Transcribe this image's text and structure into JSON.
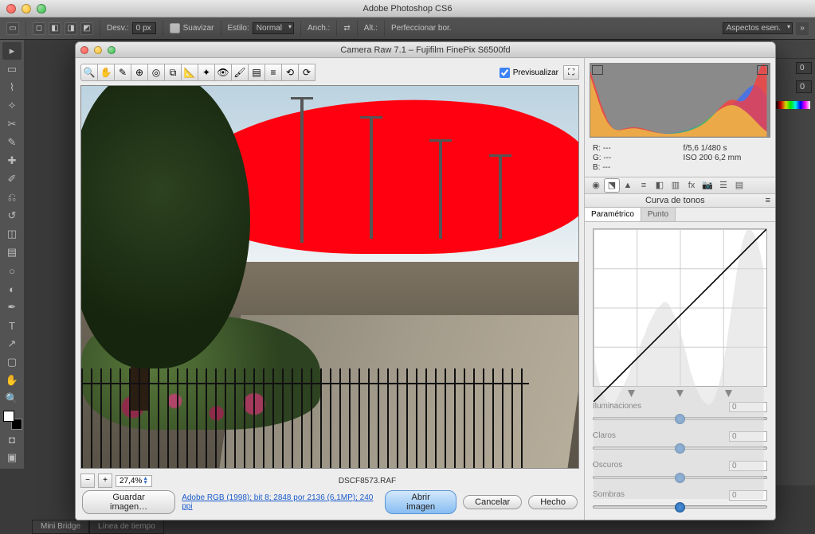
{
  "app": {
    "title": "Adobe Photoshop CS6"
  },
  "options": {
    "desv_label": "Desv.:",
    "desv_value": "0 px",
    "suavizar": "Suavizar",
    "estilo_label": "Estilo:",
    "estilo_value": "Normal",
    "anch": "Anch.:",
    "alt": "Alt.:",
    "perf": "Perfeccionar bor.",
    "workspace": "Aspectos esen."
  },
  "bottom_tabs": {
    "mini_bridge": "Mini Bridge",
    "timeline": "Línea de tiempo"
  },
  "right_panel": {
    "val0": "0",
    "val1": "0"
  },
  "cr": {
    "title": "Camera Raw 7.1  –  Fujifilm FinePix S6500fd",
    "preview": "Previsualizar",
    "zoom": "27,4%",
    "filename": "DSCF8573.RAF",
    "save_image": "Guardar imagen…",
    "link": "Adobe RGB (1998); bit 8; 2848 por 2136 (6,1MP); 240 ppi",
    "open": "Abrir imagen",
    "cancel": "Cancelar",
    "done": "Hecho",
    "histogram_meta": {
      "r": "R:   ---",
      "aperture_shutter": "f/5,6   1/480 s",
      "g": "G:   ---",
      "iso_focal": "ISO 200   6,2 mm",
      "b": "B:   ---"
    },
    "panel_title": "Curva de tonos",
    "tabs": {
      "param": "Paramétrico",
      "point": "Punto"
    },
    "sliders": {
      "iluminaciones": {
        "label": "Iluminaciones",
        "value": "0"
      },
      "claros": {
        "label": "Claros",
        "value": "0"
      },
      "oscuros": {
        "label": "Oscuros",
        "value": "0"
      },
      "sombras": {
        "label": "Sombras",
        "value": "0"
      }
    }
  },
  "chart_data": {
    "type": "line",
    "title": "Curva de tonos",
    "xlabel": "",
    "ylabel": "",
    "xlim": [
      0,
      255
    ],
    "ylim": [
      0,
      255
    ],
    "series": [
      {
        "name": "tone-curve",
        "values": [
          [
            0,
            0
          ],
          [
            64,
            64
          ],
          [
            128,
            128
          ],
          [
            192,
            192
          ],
          [
            255,
            255
          ]
        ]
      }
    ],
    "background_histogram": [
      55,
      48,
      44,
      40,
      38,
      36,
      35,
      35,
      36,
      38,
      40,
      42,
      44,
      46,
      49,
      51,
      53,
      56,
      59,
      61,
      64,
      66,
      68,
      70,
      71,
      72,
      73,
      73,
      72,
      70,
      68,
      65,
      62,
      59,
      55,
      51,
      47,
      44,
      41,
      39,
      37,
      36,
      35,
      35,
      36,
      38,
      41,
      45,
      50,
      56,
      63,
      70,
      77,
      84,
      90,
      95,
      98,
      100,
      100,
      99,
      97,
      94,
      90,
      85
    ],
    "rgb_histogram": {
      "bins": 64,
      "r": [
        230,
        200,
        170,
        140,
        110,
        85,
        60,
        42,
        30,
        24,
        23,
        25,
        28,
        30,
        32,
        33,
        33,
        32,
        30,
        28,
        25,
        22,
        19,
        16,
        14,
        12,
        11,
        10,
        10,
        10,
        11,
        12,
        13,
        15,
        17,
        20,
        23,
        27,
        31,
        36,
        42,
        49,
        57,
        66,
        76,
        87,
        98,
        108,
        117,
        124,
        128,
        129,
        127,
        124,
        123,
        127,
        136,
        150,
        170,
        196,
        224,
        248,
        255,
        240
      ],
      "g": [
        210,
        180,
        150,
        120,
        92,
        70,
        52,
        38,
        29,
        24,
        22,
        23,
        25,
        27,
        28,
        29,
        29,
        28,
        26,
        24,
        22,
        19,
        17,
        15,
        13,
        12,
        11,
        11,
        11,
        12,
        13,
        14,
        16,
        18,
        21,
        24,
        27,
        31,
        36,
        41,
        47,
        54,
        62,
        70,
        78,
        86,
        93,
        99,
        104,
        108,
        110,
        110,
        108,
        104,
        98,
        91,
        83,
        74,
        64,
        54,
        44,
        34,
        25,
        18
      ],
      "b": [
        195,
        165,
        135,
        108,
        82,
        62,
        46,
        34,
        26,
        22,
        21,
        22,
        24,
        26,
        27,
        28,
        28,
        27,
        25,
        23,
        21,
        19,
        17,
        15,
        13,
        12,
        12,
        12,
        12,
        13,
        14,
        15,
        17,
        19,
        22,
        25,
        28,
        32,
        36,
        41,
        46,
        52,
        58,
        64,
        70,
        76,
        82,
        88,
        94,
        100,
        107,
        115,
        124,
        134,
        145,
        156,
        166,
        174,
        179,
        180,
        176,
        167,
        154,
        138
      ]
    }
  }
}
